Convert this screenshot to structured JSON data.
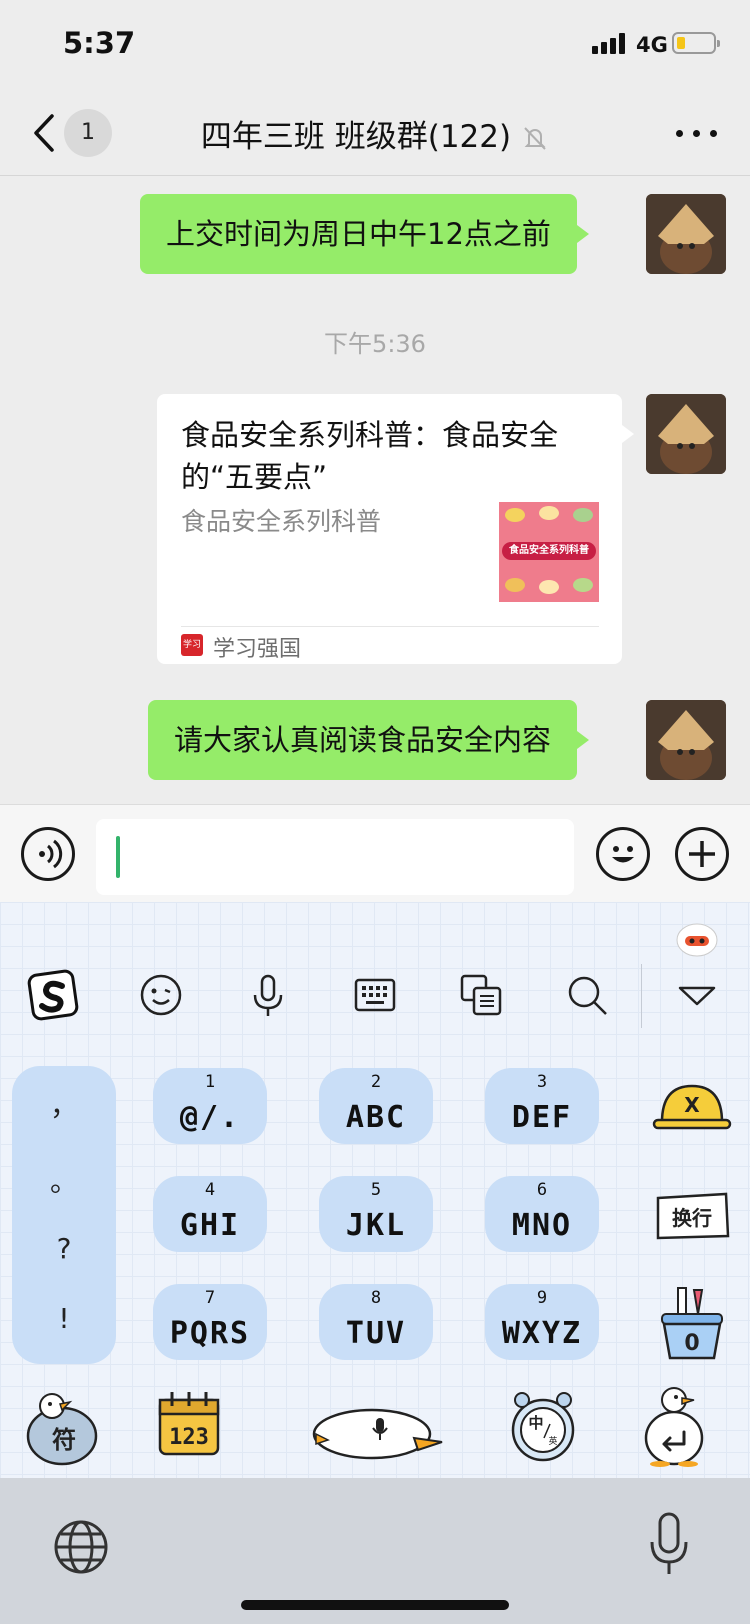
{
  "status_bar": {
    "time": "5:37",
    "network": "4G"
  },
  "nav": {
    "unread_count": "1",
    "title": "四年三班 班级群(122)"
  },
  "messages": {
    "msg1": "上交时间为周日中午12点之前",
    "time_divider": "下午5:36",
    "card": {
      "title": "食品安全系列科普：食品安全的“五要点”",
      "description": "食品安全系列科普",
      "thumbnail_text": "食品安全系列科普",
      "source_icon_text": "学习",
      "source": "学习强国"
    },
    "msg2": "请大家认真阅读食品安全内容"
  },
  "input": {
    "value": ""
  },
  "keyboard": {
    "keys": [
      {
        "num": "1",
        "letters": "@/."
      },
      {
        "num": "2",
        "letters": "ABC"
      },
      {
        "num": "3",
        "letters": "DEF"
      },
      {
        "num": "4",
        "letters": "GHI"
      },
      {
        "num": "5",
        "letters": "JKL"
      },
      {
        "num": "6",
        "letters": "MNO"
      },
      {
        "num": "7",
        "letters": "PQRS"
      },
      {
        "num": "8",
        "letters": "TUV"
      },
      {
        "num": "9",
        "letters": "WXYZ"
      }
    ],
    "punctuation": [
      "，",
      "。",
      "?",
      "!"
    ],
    "delete_label": "X",
    "newline_label": "换行",
    "zero_label": "0",
    "symbols_label": "符",
    "numbers_label": "123",
    "lang_zh": "中",
    "lang_en": "英"
  },
  "colors": {
    "bubble_green": "#95ec69",
    "caret_green": "#33b36b",
    "key_blue": "#c9def7",
    "source_red": "#d7262b"
  },
  "icons": [
    "back-icon",
    "mute-icon",
    "more-icon",
    "voice-icon",
    "emoji-icon",
    "plus-icon",
    "sogou-icon",
    "smiley-icon",
    "mic-icon",
    "keyboard-icon",
    "translate-icon",
    "search-icon",
    "collapse-icon",
    "globe-icon"
  ]
}
